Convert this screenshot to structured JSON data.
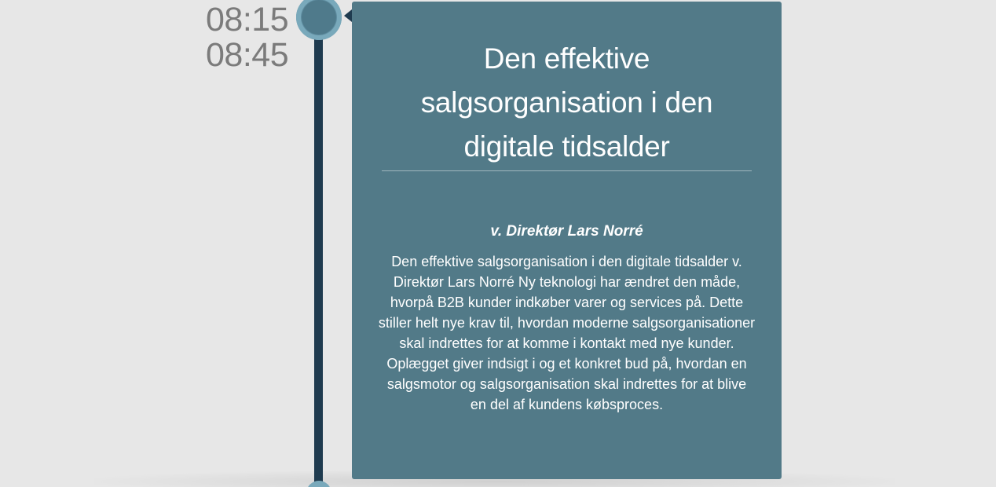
{
  "timeline": {
    "start_time": "08:15",
    "end_time": "08:45"
  },
  "session": {
    "title": "Den effektive salgsorganisation i den digitale tidsalder",
    "speaker": "v. Direktør Lars Norré",
    "description": "Den effektive salgsorganisation i den digitale tidsalder v. Direktør Lars Norré Ny teknologi har ændret den måde, hvorpå B2B kunder indkøber varer og services på. Dette stiller helt nye krav til, hvordan moderne salgsorganisationer skal indrettes for at komme i kontakt med nye kunder. Oplægget giver indsigt i og et konkret bud på, hvordan en salgsmotor og salgsorganisation skal indrettes for at blive en del af kundens købsproces."
  },
  "colors": {
    "background": "#e7e7e7",
    "card": "#527a88",
    "timeline": "#1f3b4f",
    "node_outer": "#79a9bb",
    "node_inner": "#4f7a8b",
    "time_text": "#7b7b7b",
    "card_text": "#ffffff"
  },
  "icons": {
    "timeline_node": "circle-marker-icon",
    "card_pointer": "triangle-pointer-icon"
  }
}
